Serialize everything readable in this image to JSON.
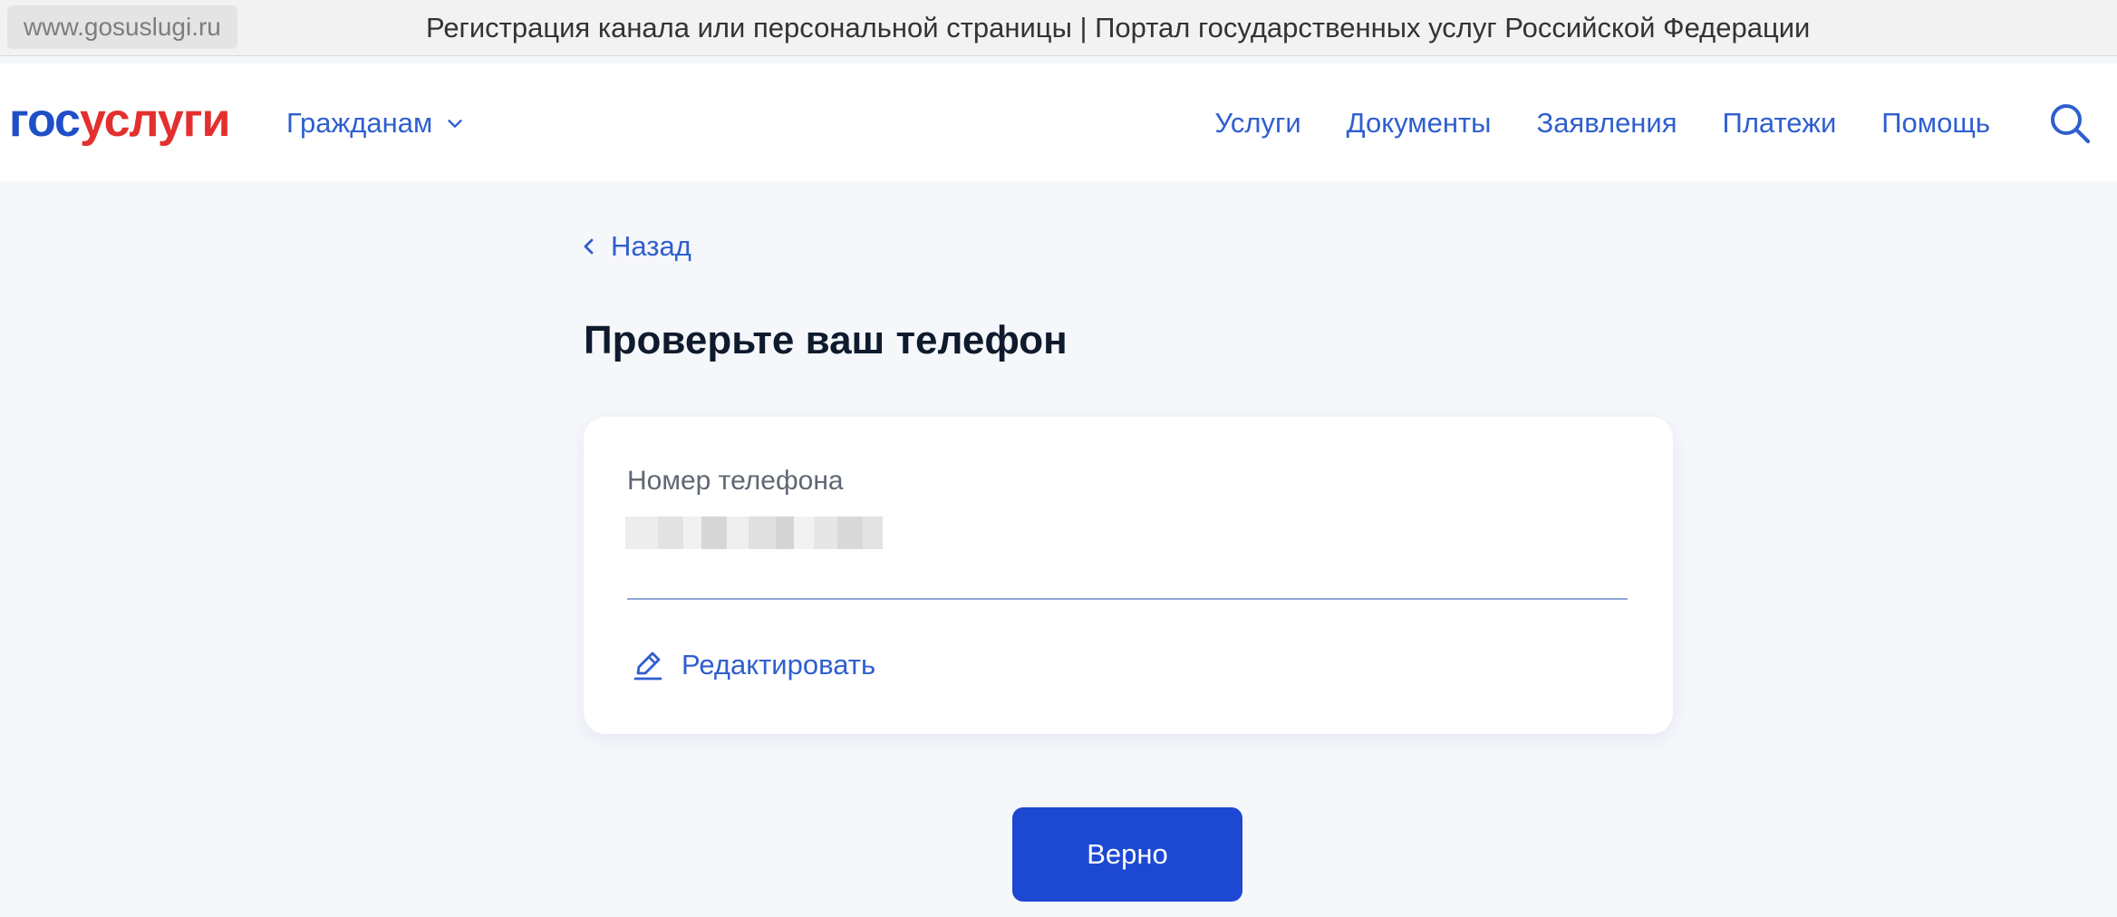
{
  "browser": {
    "url": "www.gosuslugi.ru",
    "title": "Регистрация канала или персональной страницы | Портал государственных услуг Российской Федерации"
  },
  "header": {
    "logo_part1": "гос",
    "logo_part2": "услуги",
    "audience_label": "Гражданам",
    "nav": [
      "Услуги",
      "Документы",
      "Заявления",
      "Платежи",
      "Помощь"
    ],
    "icons": {
      "audience": "chevron-down-icon",
      "search": "search-icon"
    }
  },
  "main": {
    "back_label": "Назад",
    "heading": "Проверьте ваш телефон",
    "phone_field": {
      "label": "Номер телефона",
      "value_redacted": true
    },
    "edit_label": "Редактировать",
    "confirm_label": "Верно"
  },
  "colors": {
    "brand_blue": "#1f4fc7",
    "brand_red": "#e3302f",
    "link": "#2f5fcf",
    "button": "#1d48d2",
    "background": "#f5f7fb"
  }
}
